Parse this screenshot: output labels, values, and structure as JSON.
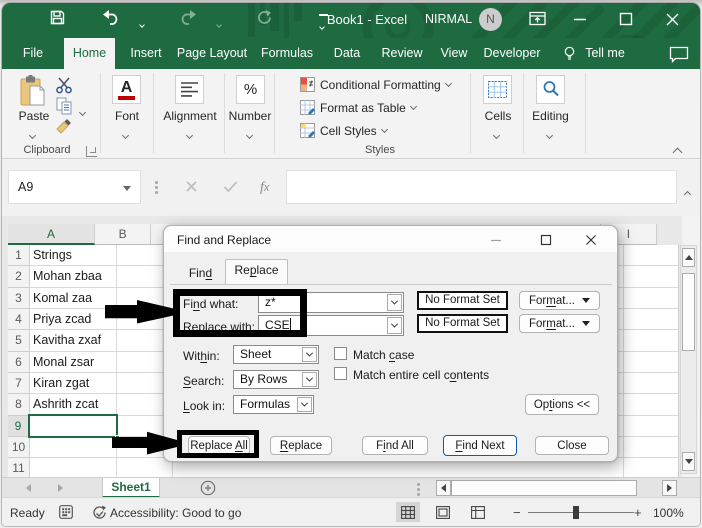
{
  "colors": {
    "excel_green": "#1e6b41",
    "title_green": "#20714575",
    "find_next_accent": "#0b5cad",
    "selection_green": "#1e6b41"
  },
  "window": {
    "title": "Book1 - Excel",
    "user": "NIRMAL",
    "avatar_initial": "N"
  },
  "ribbon_tabs": {
    "file": "File",
    "home": "Home",
    "insert": "Insert",
    "page_layout": "Page Layout",
    "formulas": "Formulas",
    "data": "Data",
    "review": "Review",
    "view": "View",
    "developer": "Developer",
    "tell_me": "Tell me"
  },
  "ribbon": {
    "clipboard": {
      "group": "Clipboard",
      "paste": "Paste"
    },
    "font_group": "Font",
    "alignment_group": "Alignment",
    "number_group": "Number",
    "number_icon": "%",
    "font_icon": "A",
    "styles": {
      "group": "Styles",
      "conditional_formatting": "Conditional Formatting",
      "format_as_table": "Format as Table",
      "cell_styles": "Cell Styles"
    },
    "cells_group": "Cells",
    "editing_group": "Editing"
  },
  "formula_bar": {
    "name_box": "A9",
    "fx_label": "fx"
  },
  "grid": {
    "selected_cell": "A9",
    "col_header_a": "A",
    "col_header_b": "B",
    "col_header_i": "I",
    "rows": [
      {
        "n": "1",
        "a": "Strings"
      },
      {
        "n": "2",
        "a": "Mohan zbaa"
      },
      {
        "n": "3",
        "a": "Komal zaa"
      },
      {
        "n": "4",
        "a": "Priya zcad"
      },
      {
        "n": "5",
        "a": "Kavitha zxaf"
      },
      {
        "n": "6",
        "a": "Monal zsar"
      },
      {
        "n": "7",
        "a": "Kiran zgat"
      },
      {
        "n": "8",
        "a": "Ashrith zcat"
      },
      {
        "n": "9",
        "a": ""
      },
      {
        "n": "10",
        "a": ""
      },
      {
        "n": "11",
        "a": ""
      }
    ]
  },
  "dialog": {
    "title": "Find and Replace",
    "tab_find": {
      "pre": "Fin",
      "key": "d",
      "post": ""
    },
    "tab_replace": {
      "pre": "Re",
      "key": "p",
      "post": "lace"
    },
    "find_what": {
      "label": {
        "pre": "Fi",
        "key": "n",
        "post": "d what:"
      },
      "value": "z*"
    },
    "replace_with": {
      "label": {
        "pre": "R",
        "key": "e",
        "post": "place with:"
      },
      "value": "CSE"
    },
    "no_format_set": "No Format Set",
    "format_button": {
      "pre": "For",
      "key": "m",
      "post": "at..."
    },
    "within": {
      "label": {
        "pre": "Wit",
        "key": "h",
        "post": "in:"
      },
      "value": "Sheet"
    },
    "search": {
      "label": {
        "pre": "",
        "key": "S",
        "post": "earch:"
      },
      "value": "By Rows"
    },
    "look_in": {
      "label": {
        "pre": "",
        "key": "L",
        "post": "ook in:"
      },
      "value": "Formulas"
    },
    "match_case": {
      "pre": "Match ",
      "key": "c",
      "post": "ase"
    },
    "match_entire": {
      "pre": "Match entire cell c",
      "key": "o",
      "post": "ntents"
    },
    "options_button": {
      "pre": "Op",
      "key": "t",
      "post": "ions <<"
    },
    "replace_all_button": {
      "pre": "Replace ",
      "key": "A",
      "post": "ll"
    },
    "replace_button": {
      "pre": "",
      "key": "R",
      "post": "eplace"
    },
    "find_all_button": {
      "pre": "F",
      "key": "i",
      "post": "nd All"
    },
    "find_next_button": {
      "pre": "",
      "key": "F",
      "post": "ind Next"
    },
    "close_button": "Close"
  },
  "sheet_bar": {
    "active_tab": "Sheet1"
  },
  "status_bar": {
    "ready": "Ready",
    "accessibility": "Accessibility: Good to go",
    "zoom_minus": "−",
    "zoom_plus": "+",
    "zoom_level": "100%"
  }
}
